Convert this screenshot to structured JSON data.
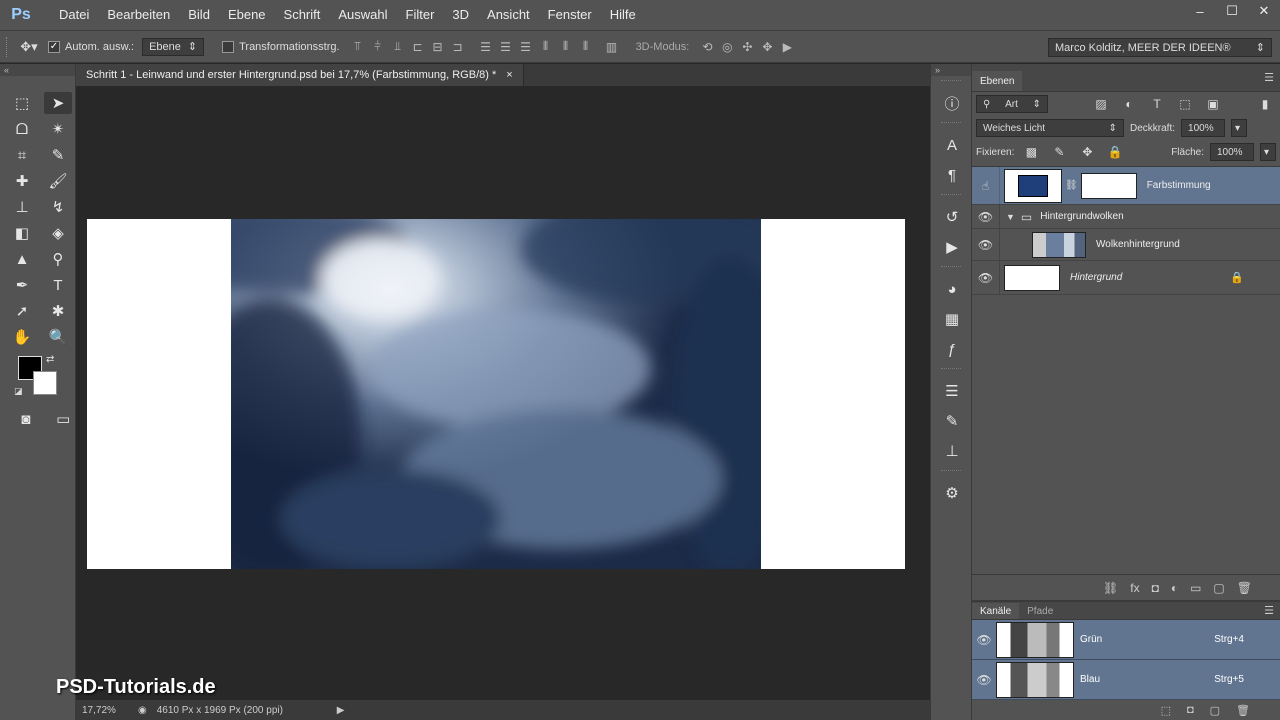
{
  "app": {
    "logo": "Ps"
  },
  "menu": [
    "Datei",
    "Bearbeiten",
    "Bild",
    "Ebene",
    "Schrift",
    "Auswahl",
    "Filter",
    "3D",
    "Ansicht",
    "Fenster",
    "Hilfe"
  ],
  "window_controls": {
    "minimize": "–",
    "maximize": "☐",
    "close": "✕"
  },
  "options": {
    "auto_select_label": "Autom. ausw.:",
    "auto_select_checked": true,
    "auto_select_value": "Ebene",
    "transform_label": "Transformationsstrg.",
    "mode_3d_label": "3D-Modus:",
    "profile": "Marco Kolditz, MEER DER IDEEN®"
  },
  "document": {
    "tab_title": "Schritt 1 - Leinwand und erster Hintergrund.psd bei 17,7% (Farbstimmung, RGB/8) *",
    "tab_close": "×",
    "zoom": "17,72%",
    "size_info": "4610 Px x 1969 Px (200 ppi)"
  },
  "watermark": "PSD-Tutorials.de",
  "layers_panel": {
    "tab": "Ebenen",
    "filter_value": "Art",
    "blend_mode": "Weiches Licht",
    "opacity_label": "Deckkraft:",
    "opacity_value": "100%",
    "lock_label": "Fixieren:",
    "fill_label": "Fläche:",
    "fill_value": "100%",
    "layers": [
      {
        "name": "Farbstimmung",
        "selected": true
      },
      {
        "name": "Hintergrundwolken",
        "group": true
      },
      {
        "name": "Wolkenhintergrund"
      },
      {
        "name": "Hintergrund",
        "locked": true
      }
    ]
  },
  "channels_panel": {
    "tabs": [
      "Kanäle",
      "Pfade"
    ],
    "channels": [
      {
        "name": "Grün",
        "shortcut": "Strg+4"
      },
      {
        "name": "Blau",
        "shortcut": "Strg+5"
      }
    ]
  },
  "colors": {
    "fill_layer": "#1e3f7a",
    "selection": "#617590",
    "accent": "#9ccfff"
  }
}
